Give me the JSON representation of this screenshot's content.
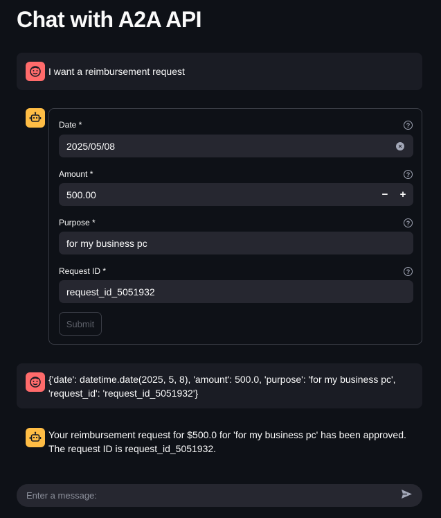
{
  "page": {
    "title": "Chat with A2A API"
  },
  "messages": {
    "m1": {
      "role": "user",
      "text": "I want a reimbursement request"
    },
    "m3": {
      "role": "user",
      "text": "{'date': datetime.date(2025, 5, 8), 'amount': 500.0, 'purpose': 'for my business pc', 'request_id': 'request_id_5051932'}"
    },
    "m4": {
      "role": "assistant",
      "text": "Your reimbursement request for $500.0 for 'for my business pc' has been approved. The request ID is request_id_5051932."
    }
  },
  "form": {
    "date": {
      "label": "Date *",
      "value": "2025/05/08"
    },
    "amount": {
      "label": "Amount *",
      "value": "500.00",
      "minus": "−",
      "plus": "+"
    },
    "purpose": {
      "label": "Purpose *",
      "value": "for my business pc"
    },
    "request_id": {
      "label": "Request ID *",
      "value": "request_id_5051932"
    },
    "submit_label": "Submit",
    "help_glyph": "?"
  },
  "chat_input": {
    "placeholder": "Enter a message:"
  },
  "icons": {
    "user_avatar": "smiley-face-icon",
    "assistant_avatar": "robot-icon",
    "help": "help-circle-icon",
    "clear": "clear-icon",
    "send": "send-icon"
  },
  "colors": {
    "background": "#0e1117",
    "user_avatar": "#ff6b6b",
    "assistant_avatar": "#ffbd45",
    "field": "#262730",
    "user_message_bg": "#1a1c24"
  }
}
